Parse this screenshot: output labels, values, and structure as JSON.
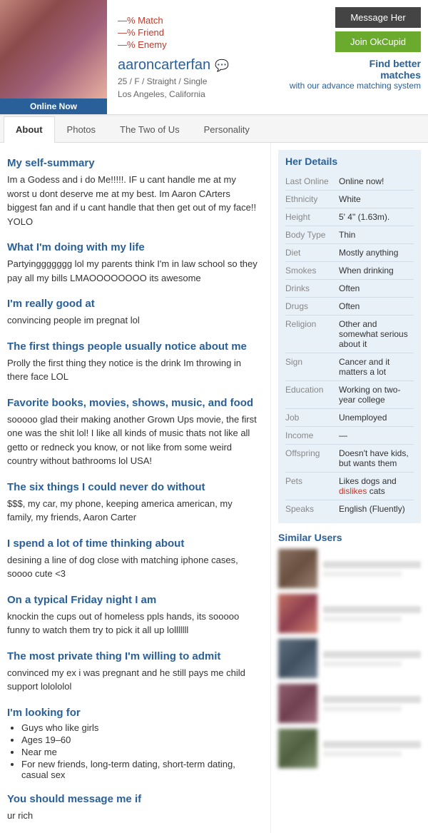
{
  "header": {
    "match_percent": "—% Match",
    "friend_percent": "—% Friend",
    "enemy_percent": "—% Enemy",
    "username": "aaroncarterfan",
    "age_gender_orientation": "25 / F / Straight / Single",
    "location": "Los Angeles, California",
    "online_badge": "Online Now",
    "btn_message": "Message Her",
    "btn_join": "Join OkCupid",
    "find_better_title": "Find better",
    "find_better_subtitle": "matches",
    "find_better_detail": "with our advance matching system"
  },
  "tabs": [
    {
      "label": "About",
      "active": true
    },
    {
      "label": "Photos",
      "active": false
    },
    {
      "label": "The Two of Us",
      "active": false
    },
    {
      "label": "Personality",
      "active": false
    }
  ],
  "sections": [
    {
      "title": "My self-summary",
      "body": "Im a Godess and i do Me!!!!!. IF u cant handle me at my worst u dont deserve me at my best. Im Aaron CArters biggest fan and if u cant handle that then get out of my face!! YOLO"
    },
    {
      "title": "What I'm doing with my life",
      "body": "Partyinggggggg lol my parents think I'm in law school so they pay all my bills LMAOOOOOOOO its awesome"
    },
    {
      "title": "I'm really good at",
      "body": "convincing people im pregnat lol"
    },
    {
      "title": "The first things people usually notice about me",
      "body": "Prolly the first thing they notice is the drink Im throwing in there face LOL"
    },
    {
      "title": "Favorite books, movies, shows, music, and food",
      "body": "sooooo glad their making another Grown Ups movie, the first one was the shit lol! I like all kinds of music thats not like all getto or redneck you know, or not like from some weird country without bathrooms lol USA!"
    },
    {
      "title": "The six things I could never do without",
      "body": "$$$, my car, my phone, keeping america american, my family, my friends, Aaron Carter"
    },
    {
      "title": "I spend a lot of time thinking about",
      "body": "desining a line of dog close with matching iphone cases, soooo cute <3"
    },
    {
      "title": "On a typical Friday night I am",
      "body": "knockin the cups out of homeless ppls hands, its sooooo funny to watch them try to pick it all up lolllllll"
    },
    {
      "title": "The most private thing I'm willing to admit",
      "body": "convinced my ex i was pregnant and he still pays me child support lolololol"
    }
  ],
  "looking_for": {
    "title": "I'm looking for",
    "items": [
      "Guys who like girls",
      "Ages 19–60",
      "Near me",
      "For new friends, long-term dating, short-term dating, casual sex"
    ]
  },
  "message_if": {
    "title": "You should message me if",
    "body": "ur rich"
  },
  "her_details": {
    "title": "Her Details",
    "rows": [
      {
        "label": "Last Online",
        "value": "Online now!"
      },
      {
        "label": "Ethnicity",
        "value": "White"
      },
      {
        "label": "Height",
        "value": "5' 4\" (1.63m)."
      },
      {
        "label": "Body Type",
        "value": "Thin"
      },
      {
        "label": "Diet",
        "value": "Mostly anything"
      },
      {
        "label": "Smokes",
        "value": "When drinking"
      },
      {
        "label": "Drinks",
        "value": "Often"
      },
      {
        "label": "Drugs",
        "value": "Often"
      },
      {
        "label": "Religion",
        "value": "Other and somewhat serious about it"
      },
      {
        "label": "Sign",
        "value": "Cancer and it matters a lot"
      },
      {
        "label": "Education",
        "value": "Working on two-year college"
      },
      {
        "label": "Job",
        "value": "Unemployed"
      },
      {
        "label": "Income",
        "value": "—"
      },
      {
        "label": "Offspring",
        "value": "Doesn't have kids, but wants them"
      },
      {
        "label": "Pets",
        "value": "Likes dogs and dislikes cats",
        "has_dislikes": true,
        "dislikes_word": "dislikes"
      },
      {
        "label": "Speaks",
        "value": "English (Fluently)"
      }
    ]
  },
  "similar_users": {
    "title": "Similar Users",
    "count": 5
  }
}
